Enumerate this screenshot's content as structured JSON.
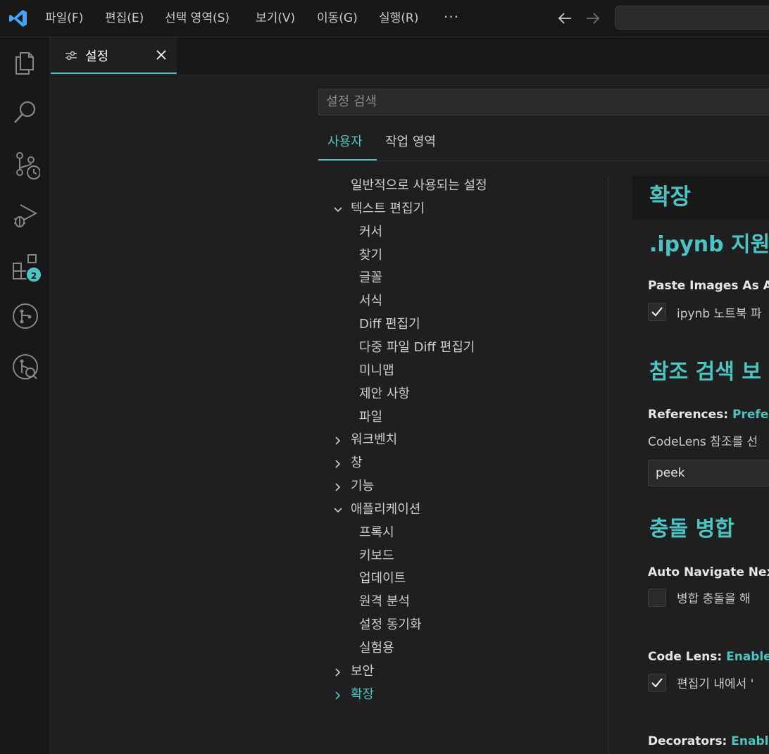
{
  "colors": {
    "accent": "#4dc4c4",
    "vscode_blue": "#3ea6ff",
    "background": "#1f1f1f",
    "titlebar": "#181818"
  },
  "titlebar": {
    "menus": [
      "파일(F)",
      "편집(E)",
      "선택 영역(S)",
      "보기(V)",
      "이동(G)",
      "실행(R)"
    ],
    "more": "···",
    "icons": [
      "vscode-logo-icon",
      "back-arrow-icon",
      "forward-arrow-icon"
    ]
  },
  "activitybar": {
    "icons": [
      "explorer-icon",
      "search-icon",
      "source-control-icon",
      "run-debug-icon",
      "extensions-icon",
      "git-graph-icon",
      "git-history-icon"
    ],
    "extensions_badge": "2"
  },
  "editor": {
    "tab_title": "설정"
  },
  "settings": {
    "search_placeholder": "설정 검색",
    "scope_tabs": [
      "사용자",
      "작업 영역"
    ],
    "toc": [
      {
        "label": "일반적으로 사용되는 설정",
        "level": 0,
        "chevron": "none"
      },
      {
        "label": "텍스트 편집기",
        "level": 0,
        "chevron": "down"
      },
      {
        "label": "커서",
        "level": 1,
        "chevron": "none"
      },
      {
        "label": "찾기",
        "level": 1,
        "chevron": "none"
      },
      {
        "label": "글꼴",
        "level": 1,
        "chevron": "none"
      },
      {
        "label": "서식",
        "level": 1,
        "chevron": "none"
      },
      {
        "label": "Diff 편집기",
        "level": 1,
        "chevron": "none"
      },
      {
        "label": "다중 파일 Diff 편집기",
        "level": 1,
        "chevron": "none"
      },
      {
        "label": "미니맵",
        "level": 1,
        "chevron": "none"
      },
      {
        "label": "제안 사항",
        "level": 1,
        "chevron": "none"
      },
      {
        "label": "파일",
        "level": 1,
        "chevron": "none"
      },
      {
        "label": "워크벤치",
        "level": 0,
        "chevron": "right"
      },
      {
        "label": "창",
        "level": 0,
        "chevron": "right"
      },
      {
        "label": "기능",
        "level": 0,
        "chevron": "right"
      },
      {
        "label": "애플리케이션",
        "level": 0,
        "chevron": "down"
      },
      {
        "label": "프록시",
        "level": 1,
        "chevron": "none"
      },
      {
        "label": "키보드",
        "level": 1,
        "chevron": "none"
      },
      {
        "label": "업데이트",
        "level": 1,
        "chevron": "none"
      },
      {
        "label": "원격 분석",
        "level": 1,
        "chevron": "none"
      },
      {
        "label": "설정 동기화",
        "level": 1,
        "chevron": "none"
      },
      {
        "label": "실험용",
        "level": 1,
        "chevron": "none"
      },
      {
        "label": "보안",
        "level": 0,
        "chevron": "right"
      },
      {
        "label": "확장",
        "level": 0,
        "chevron": "right",
        "active": true
      }
    ],
    "group_title": "확장",
    "sections": {
      "ipynb": {
        "title": ".ipynb 지원",
        "setting_label": "Paste Images As Att",
        "checkbox_text": "ipynb 노트북 파",
        "checked": true
      },
      "references": {
        "title": "참조 검색 보",
        "label_prefix": "References:",
        "label_value": "Preferre",
        "description": "CodeLens 참조를 선",
        "dropdown_value": "peek"
      },
      "merge": {
        "title": "충돌 병합",
        "auto_nav_label": "Auto Navigate Next",
        "auto_nav_text": "병합 충돌을 해",
        "auto_nav_checked": false,
        "codelens_prefix": "Code Lens:",
        "codelens_value": "Enabled",
        "codelens_text": "편집기 내에서 '",
        "codelens_checked": true,
        "decorators_prefix": "Decorators:",
        "decorators_value": "Enabled"
      }
    }
  }
}
